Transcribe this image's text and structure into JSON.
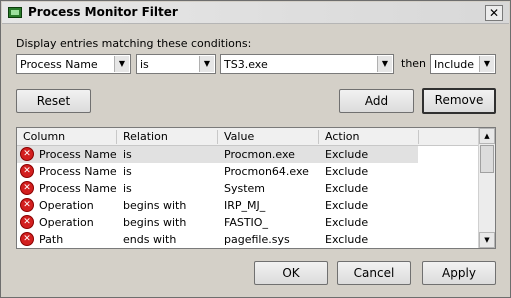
{
  "window": {
    "title": "Process Monitor Filter",
    "close_symbol": "✕"
  },
  "condition": {
    "label": "Display entries matching these conditions:",
    "column_value": "Process Name",
    "relation_value": "is",
    "value_text": "TS3.exe",
    "then_label": "then",
    "action_value": "Include"
  },
  "buttons": {
    "reset": "Reset",
    "add": "Add",
    "remove": "Remove",
    "ok": "OK",
    "cancel": "Cancel",
    "apply": "Apply"
  },
  "table": {
    "headers": [
      "Column",
      "Relation",
      "Value",
      "Action"
    ],
    "rows": [
      {
        "column": "Process Name",
        "relation": "is",
        "value": "Procmon.exe",
        "action": "Exclude"
      },
      {
        "column": "Process Name",
        "relation": "is",
        "value": "Procmon64.exe",
        "action": "Exclude"
      },
      {
        "column": "Process Name",
        "relation": "is",
        "value": "System",
        "action": "Exclude"
      },
      {
        "column": "Operation",
        "relation": "begins with",
        "value": "IRP_MJ_",
        "action": "Exclude"
      },
      {
        "column": "Operation",
        "relation": "begins with",
        "value": "FASTIO_",
        "action": "Exclude"
      },
      {
        "column": "Path",
        "relation": "ends with",
        "value": "pagefile.sys",
        "action": "Exclude"
      }
    ]
  },
  "icons": {
    "exclude": "red-x-circle-icon",
    "dropdown": "chevron-down-icon",
    "scroll_up": "arrow-up-icon",
    "scroll_down": "arrow-down-icon",
    "app": "procmon-icon"
  }
}
